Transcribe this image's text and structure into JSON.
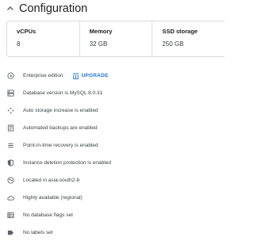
{
  "header": {
    "title": "Configuration",
    "expand_icon": "chevron-up-icon"
  },
  "stats": [
    {
      "label": "vCPUs",
      "value": "8"
    },
    {
      "label": "Memory",
      "value": "32 GB"
    },
    {
      "label": "SSD storage",
      "value": "250 GB"
    }
  ],
  "rows": [
    {
      "icon": "globe-icon",
      "text": "Enterprise edition",
      "action": "UPGRADE"
    },
    {
      "icon": "database-icon",
      "text": "Database version is MySQL 8.0.31"
    },
    {
      "icon": "expand-arrows-icon",
      "text": "Auto storage increase is enabled"
    },
    {
      "icon": "backup-icon",
      "text": "Automated backups are enabled"
    },
    {
      "icon": "recovery-icon",
      "text": "Point-in-time recovery is enabled"
    },
    {
      "icon": "shield-icon",
      "text": "Instance deletion protection is enabled"
    },
    {
      "icon": "location-globe-icon",
      "text": "Located in asia-south2-b"
    },
    {
      "icon": "cloud-icon",
      "text": "Highly available (regional)"
    },
    {
      "icon": "flags-list-icon",
      "text": "No database flags set"
    },
    {
      "icon": "label-icon",
      "text": "No labels set"
    }
  ],
  "colors": {
    "accent": "#1a73e8",
    "text": "#3c4043",
    "border": "#dadce0"
  }
}
